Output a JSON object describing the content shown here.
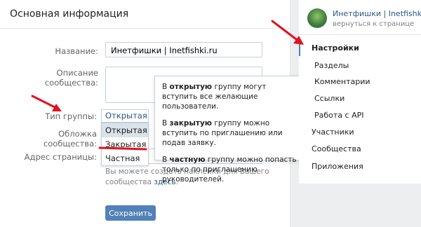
{
  "main": {
    "title": "Основная информация",
    "name_label": "Название:",
    "name_value": "Инетфишки | Inetfishki.ru",
    "desc_label": "Описание сообщества:",
    "type_label": "Тип группы:",
    "type_selected": "Открытая",
    "cover_label": "Обложка сообщества:",
    "address_label": "Адрес страницы:",
    "address_value": "",
    "type_options": [
      "Открытая",
      "Закрытая",
      "Частная"
    ],
    "hint_text": "Вы можете создать наклейки для Вашего сообщества ",
    "hint_link": "здесь",
    "save_label": "Сохранить"
  },
  "tooltip": {
    "p1_pre": "В ",
    "p1_bold": "открытую",
    "p1_post": " группу могут вступить все желающие пользователи.",
    "p2_pre": "В ",
    "p2_bold": "закрытую",
    "p2_post": " группу можно вступить по приглашению или подав заявку.",
    "p3_pre": "В ",
    "p3_bold": "частную",
    "p3_post": " группу можно попасть только по приглашению руководителей."
  },
  "sidebar": {
    "community_name": "Инетфишки | Inetfishki.ru",
    "back_link": "вернуться к странице",
    "items": [
      {
        "label": "Настройки"
      },
      {
        "label": "Разделы"
      },
      {
        "label": "Комментарии"
      },
      {
        "label": "Ссылки"
      },
      {
        "label": "Работа с API"
      },
      {
        "label": "Участники"
      },
      {
        "label": "Сообщества"
      },
      {
        "label": "Приложения"
      }
    ]
  },
  "colors": {
    "accent": "#5181b8",
    "link": "#2a5885",
    "annotation": "#e0141e"
  }
}
